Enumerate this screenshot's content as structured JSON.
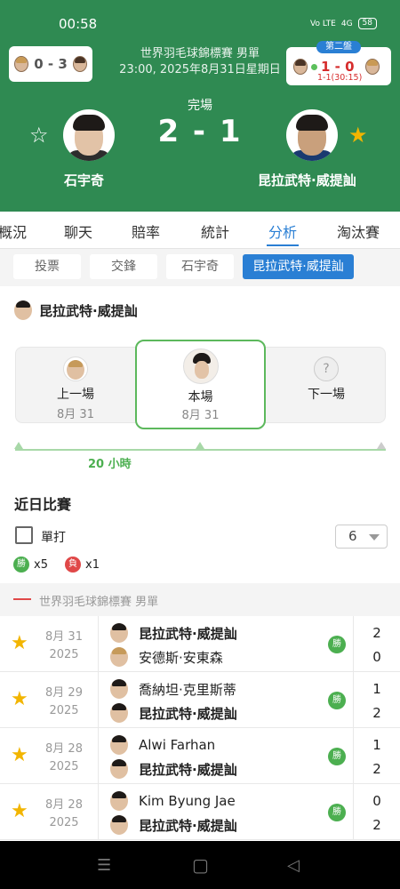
{
  "status": {
    "time": "00:58",
    "sim1": "Vo LTE",
    "signal": "4G",
    "battery": "58"
  },
  "header": {
    "event_line1": "世界羽毛球錦標賽 男單",
    "event_line2": "23:00, 2025年8月31日星期日",
    "status": "完場",
    "score": "2 - 1",
    "player1": "石宇奇",
    "player2": "昆拉武特·威提訕",
    "prev_match_score": "0 - 3",
    "live_badge": "第二盤",
    "live_score": "1 - 0",
    "live_sub": "1-1(30:15)"
  },
  "tabs": [
    "概況",
    "聊天",
    "賠率",
    "統計",
    "分析",
    "淘汰賽"
  ],
  "active_tab": "分析",
  "subtabs": [
    "投票",
    "交鋒",
    "石宇奇",
    "昆拉武特·威提訕"
  ],
  "active_subtab": "昆拉武特·威提訕",
  "focus_player": "昆拉武特·威提訕",
  "timeline": {
    "prev": {
      "label": "上一場",
      "date": "8月 31"
    },
    "current": {
      "label": "本場",
      "date": "8月 31"
    },
    "next": {
      "label": "下一場"
    },
    "gap": "20 小時"
  },
  "recent": {
    "title": "近日比賽",
    "filter_label": "單打",
    "count": "6",
    "wins_label": "勝",
    "wins": "x5",
    "losses_label": "負",
    "losses": "x1"
  },
  "tournament": "世界羽毛球錦標賽 男單",
  "matches": [
    {
      "date": "8月 31",
      "year": "2025",
      "p1": "昆拉武特·威提訕",
      "p2": "安德斯·安東森",
      "s1": "2",
      "s2": "0",
      "result": "勝",
      "p1_bold": true,
      "p2_bold": false
    },
    {
      "date": "8月 29",
      "year": "2025",
      "p1": "喬納坦·克里斯蒂",
      "p2": "昆拉武特·威提訕",
      "s1": "1",
      "s2": "2",
      "result": "勝",
      "p1_bold": false,
      "p2_bold": true
    },
    {
      "date": "8月 28",
      "year": "2025",
      "p1": "Alwi Farhan",
      "p2": "昆拉武特·威提訕",
      "s1": "1",
      "s2": "2",
      "result": "勝",
      "p1_bold": false,
      "p2_bold": true
    },
    {
      "date": "8月 28",
      "year": "2025",
      "p1": "Kim Byung Jae",
      "p2": "昆拉武特·威提訕",
      "s1": "0",
      "s2": "2",
      "result": "勝",
      "p1_bold": false,
      "p2_bold": true
    }
  ],
  "colors": {
    "header_green": "#2f8a52",
    "accent_blue": "#2a7fd4",
    "win_green": "#4caf50",
    "loss_red": "#e04848",
    "star_gold": "#f2b500"
  }
}
